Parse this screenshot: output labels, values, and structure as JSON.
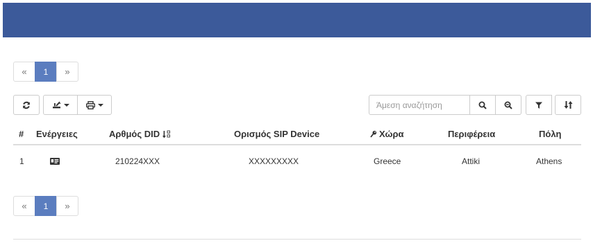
{
  "pager_top": {
    "prev": "«",
    "page": "1",
    "next": "»"
  },
  "pager_bottom": {
    "prev": "«",
    "page": "1",
    "next": "»"
  },
  "toolbar": {
    "search_placeholder": "Άμεση αναζήτηση"
  },
  "table": {
    "headers": {
      "index": "#",
      "actions": "Ενέργειες",
      "did": "Αρθμός DID",
      "sip": "Ορισμός SIP Device",
      "country": "Χώρα",
      "region": "Περιφέρεια",
      "city": "Πόλη"
    },
    "rows": [
      {
        "index": "1",
        "did": "210224XXX",
        "sip": "XXXXXXXXX",
        "country": "Greece",
        "region": "Attiki",
        "city": "Athens"
      }
    ]
  },
  "colors": {
    "header_bar": "#3c5a9a",
    "active_page": "#5b7dbf"
  }
}
